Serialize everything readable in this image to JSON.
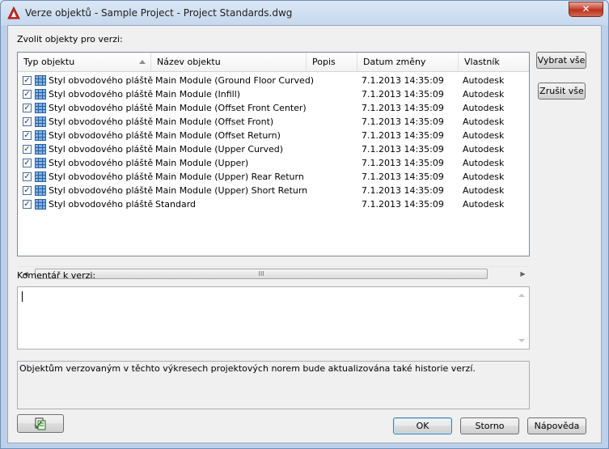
{
  "window": {
    "title": "Verze objektů - Sample Project - Project Standards.dwg",
    "close_glyph": "✕"
  },
  "select_label": "Zvolit objekty pro verzi:",
  "list": {
    "columns": [
      "Typ objektu",
      "Název objektu",
      "Popis",
      "Datum změny",
      "Vlastník"
    ],
    "rows": [
      {
        "type": "Styl obvodového pláště",
        "name": "Main Module (Ground Floor Curved)",
        "desc": "",
        "date": "7.1.2013 14:35:09",
        "owner": "Autodesk",
        "checked": true
      },
      {
        "type": "Styl obvodového pláště",
        "name": "Main Module (Infill)",
        "desc": "",
        "date": "7.1.2013 14:35:09",
        "owner": "Autodesk",
        "checked": true
      },
      {
        "type": "Styl obvodového pláště",
        "name": "Main Module (Offset Front Center)",
        "desc": "",
        "date": "7.1.2013 14:35:09",
        "owner": "Autodesk",
        "checked": true
      },
      {
        "type": "Styl obvodového pláště",
        "name": "Main Module (Offset Front)",
        "desc": "",
        "date": "7.1.2013 14:35:09",
        "owner": "Autodesk",
        "checked": true
      },
      {
        "type": "Styl obvodového pláště",
        "name": "Main Module (Offset Return)",
        "desc": "",
        "date": "7.1.2013 14:35:09",
        "owner": "Autodesk",
        "checked": true
      },
      {
        "type": "Styl obvodového pláště",
        "name": "Main Module (Upper Curved)",
        "desc": "",
        "date": "7.1.2013 14:35:09",
        "owner": "Autodesk",
        "checked": true
      },
      {
        "type": "Styl obvodového pláště",
        "name": "Main Module (Upper)",
        "desc": "",
        "date": "7.1.2013 14:35:09",
        "owner": "Autodesk",
        "checked": true
      },
      {
        "type": "Styl obvodového pláště",
        "name": "Main Module (Upper) Rear Return",
        "desc": "",
        "date": "7.1.2013 14:35:09",
        "owner": "Autodesk",
        "checked": true
      },
      {
        "type": "Styl obvodového pláště",
        "name": "Main Module (Upper) Short Return",
        "desc": "",
        "date": "7.1.2013 14:35:09",
        "owner": "Autodesk",
        "checked": true
      },
      {
        "type": "Styl obvodového pláště",
        "name": "Standard",
        "desc": "",
        "date": "7.1.2013 14:35:09",
        "owner": "Autodesk",
        "checked": true
      }
    ],
    "scroll_grip": "III"
  },
  "buttons": {
    "select_all": "Vybrat vše",
    "clear_all": "Zrušit vše",
    "ok": "OK",
    "cancel": "Storno",
    "help": "Nápověda"
  },
  "comment": {
    "label": "Komentář k verzi:",
    "value": ""
  },
  "info_text": "Objektům verzovaným v těchto výkresech projektových norem bude aktualizována také historie verzí.",
  "icons": {
    "app": "autocad-logo-icon",
    "row": "curtain-wall-style-icon",
    "checkmark": "✓",
    "bottom_left": "project-standards-icon"
  }
}
